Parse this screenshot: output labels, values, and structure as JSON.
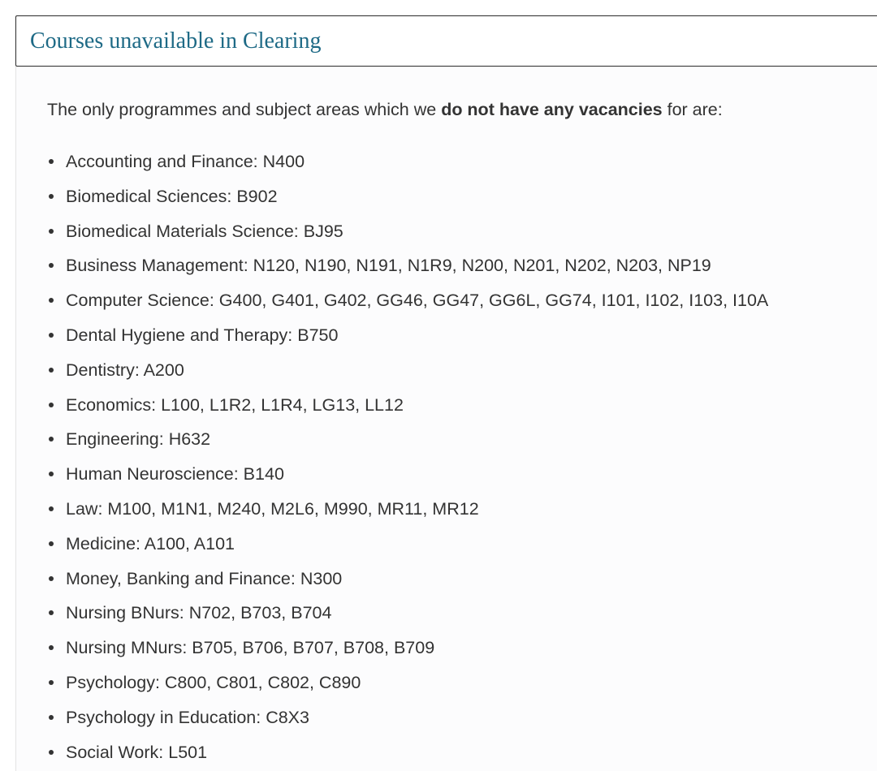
{
  "section": {
    "title": "Courses unavailable in Clearing",
    "intro": {
      "before": "The only programmes and subject areas which we ",
      "emphasis": "do not have any vacancies",
      "after": " for are:"
    },
    "courses": [
      "Accounting and Finance: N400",
      "Biomedical Sciences: B902",
      "Biomedical Materials Science: BJ95",
      "Business Management: N120, N190, N191, N1R9, N200, N201, N202, N203, NP19",
      "Computer Science: G400, G401, G402, GG46, GG47, GG6L, GG74, I101, I102, I103, I10A",
      "Dental Hygiene and Therapy: B750",
      "Dentistry: A200",
      "Economics: L100, L1R2, L1R4, LG13, LL12",
      "Engineering: H632",
      "Human Neuroscience: B140",
      "Law: M100, M1N1, M240, M2L6, M990, MR11, MR12",
      "Medicine: A100, A101",
      "Money, Banking and Finance: N300",
      "Nursing BNurs: N702, B703, B704",
      "Nursing MNurs: B705, B706, B707, B708, B709",
      "Psychology: C800, C801, C802, C890",
      "Psychology in Education: C8X3",
      "Social Work: L501"
    ]
  }
}
